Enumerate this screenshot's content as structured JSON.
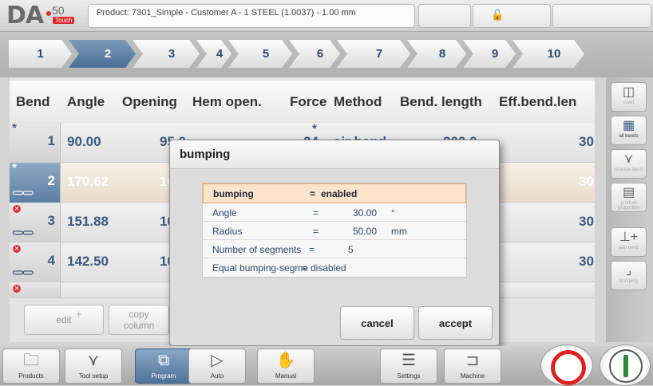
{
  "header": {
    "logo_text": "DA",
    "logo_number": "50",
    "logo_sub": "Touch",
    "product": "Product: 7301_Simple - Customer A - 1 STEEL (1.0037) - 1.00 mm",
    "lock_icon": "unlock-icon"
  },
  "tabs": [
    "1",
    "2",
    "3",
    "4",
    "5",
    "6",
    "7",
    "8",
    "9",
    "10"
  ],
  "active_tab": "2",
  "table": {
    "headers": [
      "Bend",
      "Angle",
      "Opening",
      "Hem open.",
      "Force",
      "Method",
      "Bend. length",
      "Eff.bend.len"
    ],
    "rows": [
      {
        "bend": "1",
        "angle": "90.00",
        "opening": "95.0",
        "force": "24",
        "method": "air bend",
        "length": "200.0",
        "eff": "30",
        "marker": "*"
      },
      {
        "bend": "2",
        "angle": "170.62",
        "opening": "10",
        "eff": "30",
        "marker": "*"
      },
      {
        "bend": "3",
        "angle": "151.88",
        "opening": "10",
        "eff": "30",
        "marker": "x"
      },
      {
        "bend": "4",
        "angle": "142.50",
        "opening": "10",
        "eff": "30",
        "marker": "x"
      },
      {
        "bend": "",
        "angle": "",
        "marker": "x"
      }
    ],
    "force_star": "*"
  },
  "side": {
    "items": [
      "insert",
      "all bends",
      "change bend",
      "product properties",
      "add bend",
      "bumping"
    ]
  },
  "bottom_edit": {
    "edit": "edit",
    "edit_plus": "+",
    "copy": "copy",
    "column": "column"
  },
  "dialog": {
    "title": "bumping",
    "params": [
      {
        "name": "bumping",
        "eq": "=",
        "value": "enabled",
        "unit": ""
      },
      {
        "name": "Angle",
        "eq": "=",
        "value": "30.00",
        "unit": "°"
      },
      {
        "name": "Radius",
        "eq": "=",
        "value": "50.00",
        "unit": "mm"
      },
      {
        "name": "Number of segments",
        "eq": "=",
        "value": "5",
        "unit": ""
      },
      {
        "name": "Equal bumping-segme",
        "eq": "=",
        "value": "disabled",
        "unit": ""
      }
    ],
    "cancel": "cancel",
    "accept": "accept"
  },
  "nav": [
    "Products",
    "Tool setup",
    "Program",
    "Auto",
    "Manual",
    "Settings",
    "Machine"
  ],
  "active_nav": "Program"
}
